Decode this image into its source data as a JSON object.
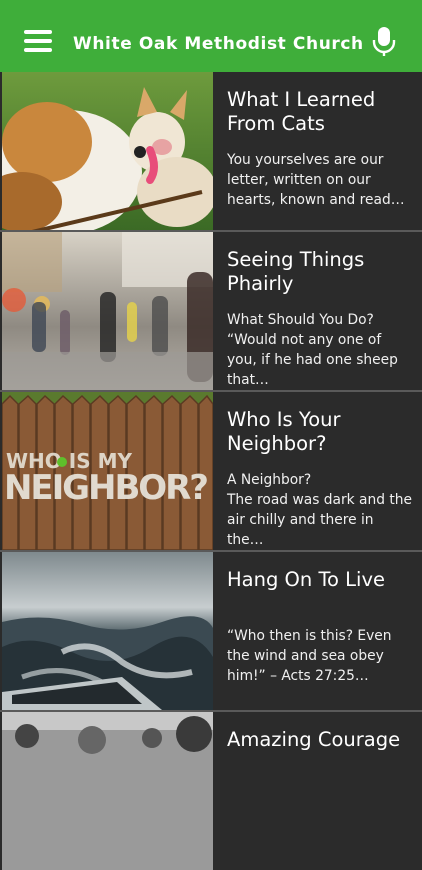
{
  "header": {
    "title": "White Oak Methodist Church",
    "menu_icon": "hamburger-menu-icon",
    "mic_icon": "microphone-icon",
    "accent_color": "#3fae3a"
  },
  "feed": {
    "items": [
      {
        "title": "What I Learned From Cats",
        "excerpt": "You yourselves are our letter, written on our hearts, known and read…"
      },
      {
        "title": "Seeing Things Phairly",
        "excerpt": "What Should You Do?\n“Would not any one of you, if he had one sheep that…"
      },
      {
        "title": "Who Is Your Neighbor?",
        "excerpt": "A Neighbor?\nThe road was dark and the air chilly and there in the…",
        "image_text_1": "WHO IS MY",
        "image_text_2": "NEIGHBOR?"
      },
      {
        "title": "Hang On To Live",
        "excerpt": "“Who then is this? Even the wind and sea obey him!” – Acts 27:25…"
      },
      {
        "title": "Amazing Courage",
        "excerpt": ""
      }
    ]
  }
}
